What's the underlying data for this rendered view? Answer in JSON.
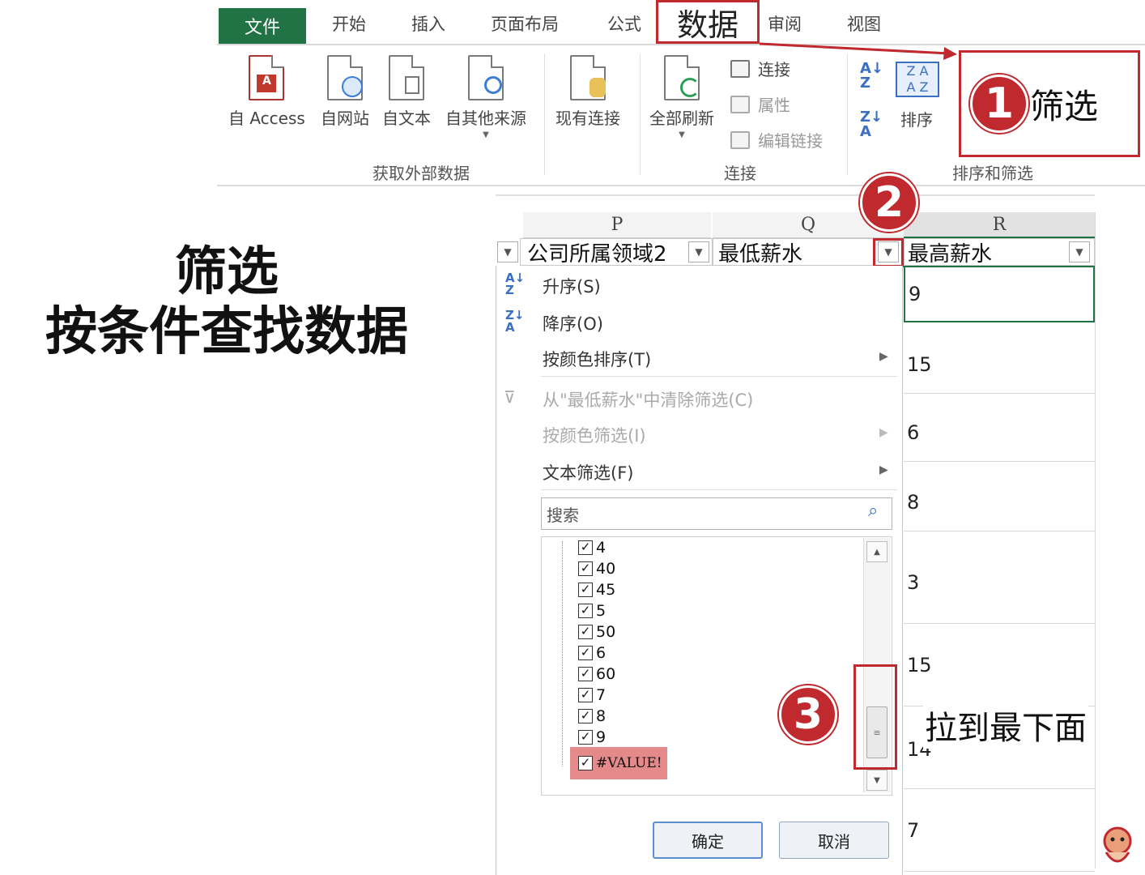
{
  "ribbon": {
    "tabs": [
      "文件",
      "开始",
      "插入",
      "页面布局",
      "公式",
      "数据",
      "审阅",
      "视图"
    ],
    "get_external": {
      "buttons": [
        "自 Access",
        "自网站",
        "自文本",
        "自其他来源",
        "现有连接"
      ],
      "group_label": "获取外部数据"
    },
    "connections": {
      "refresh_all": "全部刷新",
      "connect": "连接",
      "properties": "属性",
      "edit_links": "编辑链接",
      "group_label": "连接"
    },
    "sort_filter": {
      "sort": "排序",
      "group_label": "排序和筛选"
    }
  },
  "callouts": {
    "step1_number": "1",
    "step1_label": "筛选",
    "step2_number": "2",
    "step3_number": "3",
    "step3_label": "拉到最下面"
  },
  "title": {
    "line1": "筛选",
    "line2": "按条件查找数据"
  },
  "sheet": {
    "columns": [
      "P",
      "Q",
      "R"
    ],
    "headers": [
      "公司所属领域2",
      "最低薪水",
      "最高薪水"
    ],
    "r_values": [
      "9",
      "15",
      "6",
      "8",
      "3",
      "15",
      "14",
      "7"
    ]
  },
  "filter_menu": {
    "sort_asc": "升序(S)",
    "sort_desc": "降序(O)",
    "sort_by_color": "按颜色排序(T)",
    "clear_filter": "从\"最低薪水\"中清除筛选(C)",
    "filter_by_color": "按颜色筛选(I)",
    "text_filter": "文本筛选(F)",
    "search_placeholder": "搜索",
    "items": [
      "4",
      "40",
      "45",
      "5",
      "50",
      "6",
      "60",
      "7",
      "8",
      "9",
      "#VALUE!"
    ],
    "ok": "确定",
    "cancel": "取消"
  },
  "colors": {
    "excel_green": "#217346",
    "callout_red": "#c0292e",
    "highlight": "#e48a8a"
  }
}
